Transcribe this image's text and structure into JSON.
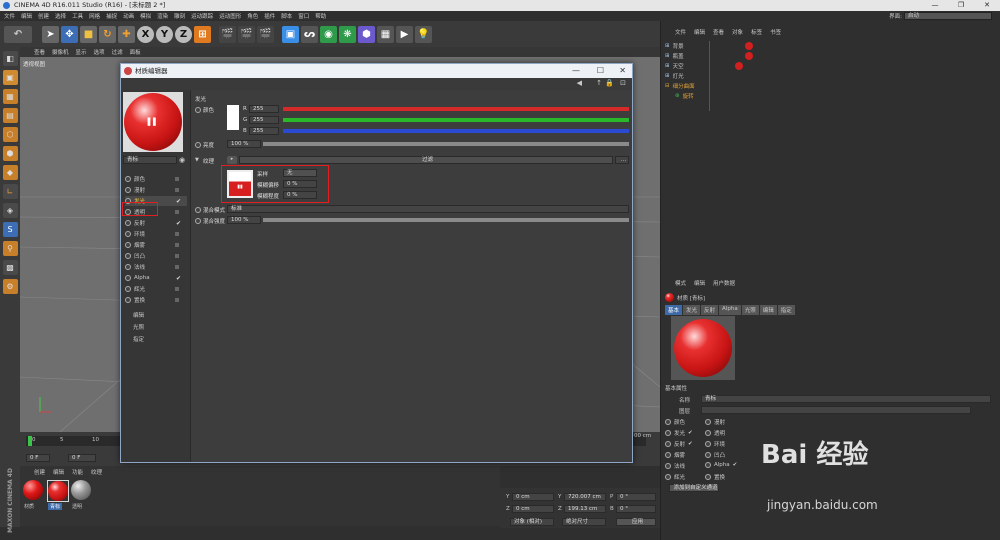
{
  "app": {
    "title": "CINEMA 4D R16.011 Studio (R16) - [未标题 2 *]",
    "window_controls": [
      "—",
      "❐",
      "✕"
    ]
  },
  "menubar": {
    "items": [
      "文件",
      "编辑",
      "创建",
      "选择",
      "工具",
      "网格",
      "捕捉",
      "动画",
      "模拟",
      "渲染",
      "雕刻",
      "运动跟踪",
      "运动图形",
      "角色",
      "插件",
      "脚本",
      "窗口",
      "帮助"
    ],
    "layout_label": "界面:",
    "layout_value": "启动"
  },
  "toolbar": {
    "icons": [
      "undo-icon",
      "select-arrow-icon",
      "move-icon",
      "scale-icon",
      "rotate-icon",
      "add-icon",
      "x-axis-icon",
      "y-axis-icon",
      "z-axis-icon",
      "world-coord-icon",
      "render-region-icon",
      "render-view-icon",
      "render-settings-icon",
      "cube-icon",
      "spline-icon",
      "nurbs-icon",
      "array-icon",
      "deformer-icon",
      "floor-icon",
      "camera-icon",
      "light-icon"
    ],
    "axis_labels": [
      "X",
      "Y",
      "Z"
    ]
  },
  "viewport": {
    "menu": [
      "查看",
      "摄像机",
      "显示",
      "选项",
      "过滤",
      "面板"
    ],
    "label": "透视视图"
  },
  "timeline": {
    "ticks": [
      "0",
      "5",
      "10"
    ],
    "start_frame": "0 F",
    "current_frame": "0 F"
  },
  "material_manager": {
    "menu": [
      "创建",
      "编辑",
      "功能",
      "纹理"
    ],
    "materials": [
      {
        "name": "材质"
      },
      {
        "name": "青标"
      },
      {
        "name": "透明"
      }
    ]
  },
  "coordinates": {
    "rows": [
      {
        "axis": "Y",
        "pos": "0 cm",
        "axis2": "Y",
        "size": "720.007 cm",
        "axis3": "P",
        "rot": "0 °"
      },
      {
        "axis": "Z",
        "pos": "0 cm",
        "axis2": "Z",
        "size": "199.13 cm",
        "axis3": "B",
        "rot": "0 °"
      }
    ],
    "mode": "对象 (相对)",
    "size_mode": "绝对尺寸",
    "apply": "应用",
    "x_partial": "00 cm"
  },
  "material_editor": {
    "title": "材质编辑器",
    "material_name": "青标",
    "channels": [
      {
        "label": "颜色",
        "checked": false
      },
      {
        "label": "漫射",
        "checked": false
      },
      {
        "label": "发光",
        "checked": true
      },
      {
        "label": "透明",
        "checked": false
      },
      {
        "label": "反射",
        "checked": true
      },
      {
        "label": "环境",
        "checked": false
      },
      {
        "label": "烟雾",
        "checked": false
      },
      {
        "label": "凹凸",
        "checked": false
      },
      {
        "label": "法线",
        "checked": false
      },
      {
        "label": "Alpha",
        "checked": true
      },
      {
        "label": "辉光",
        "checked": false
      },
      {
        "label": "置换",
        "checked": false
      }
    ],
    "extra": [
      "编辑",
      "光照",
      "指定"
    ],
    "section": "发光",
    "color_label": "颜色",
    "rgb": [
      {
        "ch": "R",
        "value": "255",
        "color": "#d42a2a"
      },
      {
        "ch": "G",
        "value": "255",
        "color": "#2ab82a"
      },
      {
        "ch": "B",
        "value": "255",
        "color": "#2a4ad4"
      }
    ],
    "brightness_label": "亮度",
    "brightness_value": "100 %",
    "texture_label": "纹理",
    "texture_filter": "过滤",
    "texture_more": "...",
    "sampling_label": "采样",
    "sampling_value": "无",
    "blur_offset_label": "模糊偏移",
    "blur_offset_value": "0 %",
    "blur_scale_label": "模糊程度",
    "blur_scale_value": "0 %",
    "mix_mode_label": "混合模式",
    "mix_mode_value": "标准",
    "mix_strength_label": "混合强度",
    "mix_strength_value": "100 %"
  },
  "object_manager": {
    "menu": [
      "文件",
      "编辑",
      "查看",
      "对象",
      "标签",
      "书签"
    ],
    "objects": [
      {
        "name": "背景",
        "color": "#9ec3ea"
      },
      {
        "name": "瓶盖",
        "color": "#9ec3ea"
      },
      {
        "name": "天空",
        "color": "#9ec3ea"
      },
      {
        "name": "灯光",
        "color": "#9ec3ea"
      },
      {
        "name": "细分曲面",
        "color": "#e0a23a"
      },
      {
        "name": "旋转",
        "color": "#e0a23a"
      }
    ]
  },
  "attributes": {
    "menu": [
      "模式",
      "编辑",
      "用户数据"
    ],
    "header": "材质 [青标]",
    "tabs": [
      "基本",
      "发光",
      "反射",
      "Alpha",
      "光照",
      "编辑",
      "指定"
    ],
    "section": "基本属性",
    "name_label": "名称",
    "name_value": "青标",
    "layer_label": "图层",
    "channels_left": [
      {
        "label": "颜色",
        "checked": false
      },
      {
        "label": "发光",
        "checked": true
      },
      {
        "label": "反射",
        "checked": true
      },
      {
        "label": "烟雾",
        "checked": false
      },
      {
        "label": "法线",
        "checked": false
      },
      {
        "label": "辉光",
        "checked": false
      }
    ],
    "channels_right": [
      {
        "label": "漫射",
        "checked": false
      },
      {
        "label": "透明",
        "checked": false
      },
      {
        "label": "环境",
        "checked": false
      },
      {
        "label": "凹凸",
        "checked": false
      },
      {
        "label": "Alpha",
        "checked": true
      },
      {
        "label": "置换",
        "checked": false
      }
    ],
    "add_button": "添加到自定义通道"
  },
  "watermark": {
    "brand": "Bai 经验",
    "url": "jingyan.baidu.com"
  },
  "maxon": "MAXON CINEMA 4D"
}
